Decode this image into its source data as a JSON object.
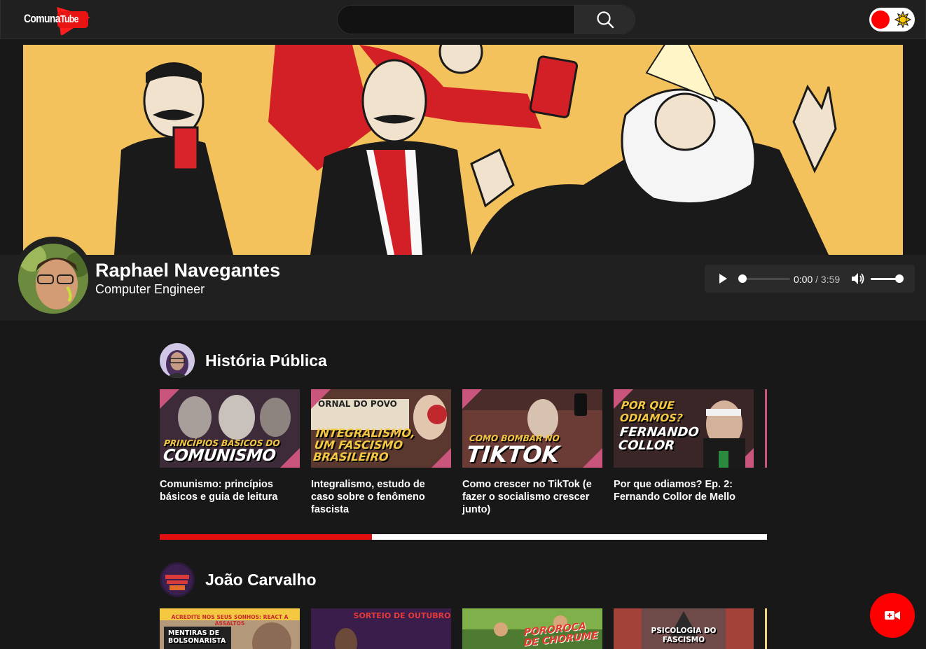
{
  "header": {
    "logo_text_a": "Comuna",
    "logo_text_b": "Tube",
    "search": {
      "value": "",
      "placeholder": ""
    },
    "search_icon": "search-icon",
    "theme_toggle": {
      "state": "dark",
      "knob_color": "#ff0000",
      "icon": "sun-icon"
    }
  },
  "profile": {
    "name": "Raphael Navegantes",
    "role": "Computer Engineer",
    "audio": {
      "current_time": "0:00",
      "separator": "/",
      "duration": "3:59",
      "progress": 0.0,
      "volume": 1.0
    }
  },
  "channels": [
    {
      "name": "História Pública",
      "videos": [
        {
          "title": "Comunismo: princípios básicos e guia de leitura",
          "thumb_text_small": "PRINCÍPIOS BÁSICOS DO",
          "thumb_text_big": "COMUNISMO"
        },
        {
          "title": "Integralismo, estudo de caso sobre o fenômeno fascista",
          "thumb_text_small": "ORNAL DO POVO",
          "thumb_text_big": "INTEGRALISMO, UM FASCISMO BRASILEIRO"
        },
        {
          "title": "Como crescer no TikTok (e fazer o socialismo crescer junto)",
          "thumb_text_small": "COMO BOMBAR NO",
          "thumb_text_big": "TIKTOK"
        },
        {
          "title": "Por que odiamos? Ep. 2: Fernando Collor de Mello",
          "thumb_text_small": "POR QUE ODIAMOS?",
          "thumb_text_big": "FERNANDO COLLOR"
        }
      ],
      "scroll_progress": 0.35
    },
    {
      "name": "João Carvalho",
      "videos": [
        {
          "thumb_text": "ACREDITE NOS SEUS SONHOS: REACT A ASSALTOS",
          "thumb_text_big": "MENTIRAS DE BOLSONARISTA"
        },
        {
          "thumb_text": "SORTEIO DE OUTUBRO"
        },
        {
          "thumb_text": "POROROCA DE CHORUME"
        },
        {
          "thumb_text": "PSICOLOGIA DO FASCISMO"
        }
      ]
    }
  ],
  "fab": {
    "icon": "video-camera-icon",
    "color": "#ff0000"
  },
  "colors": {
    "accent": "#ff0000",
    "background": "#181818",
    "surface": "#202020"
  }
}
